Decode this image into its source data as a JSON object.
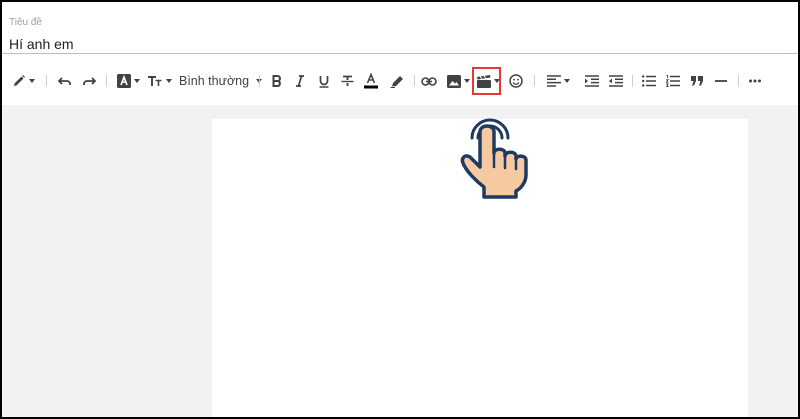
{
  "title_field": {
    "label": "Tiêu đề",
    "value": "Hí anh em"
  },
  "toolbar": {
    "font_style": "Bình thường",
    "highlighted_tool": "insert-video-button",
    "icons": [
      "pencil-icon",
      "undo-icon",
      "redo-icon",
      "font-color-box-icon",
      "text-size-icon",
      "bold-icon",
      "italic-icon",
      "underline-icon",
      "strikethrough-icon",
      "text-color-icon",
      "highlighter-icon",
      "link-icon",
      "image-icon",
      "video-icon",
      "emoji-icon",
      "align-left-icon",
      "indent-icon",
      "outdent-icon",
      "bulleted-list-icon",
      "numbered-list-icon",
      "quote-icon",
      "horizontal-rule-icon",
      "more-icon"
    ]
  },
  "colors": {
    "title_underline": "#e8b48f",
    "highlight_border": "#e53935",
    "text_color_bar": "#000000",
    "canvas_bg": "#f2f2f2",
    "hand_fill": "#f6c9a0",
    "hand_outline": "#1f3a5f"
  }
}
